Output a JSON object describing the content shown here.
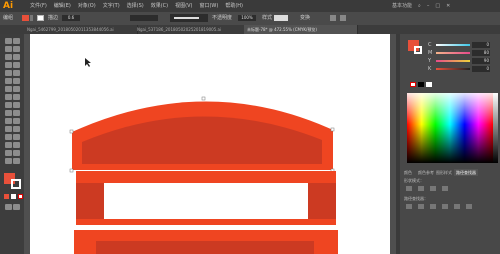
{
  "app": {
    "logo": "Ai"
  },
  "menubar": {
    "items": [
      "文件(F)",
      "编辑(E)",
      "对象(O)",
      "文字(T)",
      "选择(S)",
      "效果(C)",
      "视图(V)",
      "窗口(W)",
      "帮助(H)"
    ],
    "right_label": "基本功能"
  },
  "options_bar": {
    "selection_label": "编组",
    "stroke_label": "描边",
    "stroke_value": "0.6",
    "opacity_label": "不透明度",
    "opacity_value": "100%",
    "style_label": "样式",
    "transform_label": "变换"
  },
  "tabs": [
    {
      "label": "Ngai_5462799_20180502011353844056.ai",
      "active": false
    },
    {
      "label": "Ngai_537186_20180502025201819005.ai",
      "active": false
    },
    {
      "label": "未标题-78* @ 472.55% (CMYK/预览)",
      "active": true
    }
  ],
  "color_panel": {
    "sliders": [
      {
        "label": "C",
        "value": "0",
        "color": "#3ec7e8"
      },
      {
        "label": "M",
        "value": "80",
        "color": "#e84a8a"
      },
      {
        "label": "Y",
        "value": "90",
        "color": "#f0d23a"
      },
      {
        "label": "K",
        "value": "0",
        "color": "#888888"
      }
    ],
    "fill_color": "#e8503a"
  },
  "panel_tabs": [
    {
      "label": "颜色",
      "active": false
    },
    {
      "label": "颜色参考",
      "active": false
    },
    {
      "label": "图形样式",
      "active": false
    },
    {
      "label": "路径查找器",
      "active": true
    }
  ],
  "pathfinder": {
    "shape_modes_label": "形状模式：",
    "pathfinders_label": "路径查找器："
  },
  "artwork": {
    "main_red": "#ef4521",
    "dark_red": "#cc3a22",
    "mid_red": "#e8573a"
  }
}
